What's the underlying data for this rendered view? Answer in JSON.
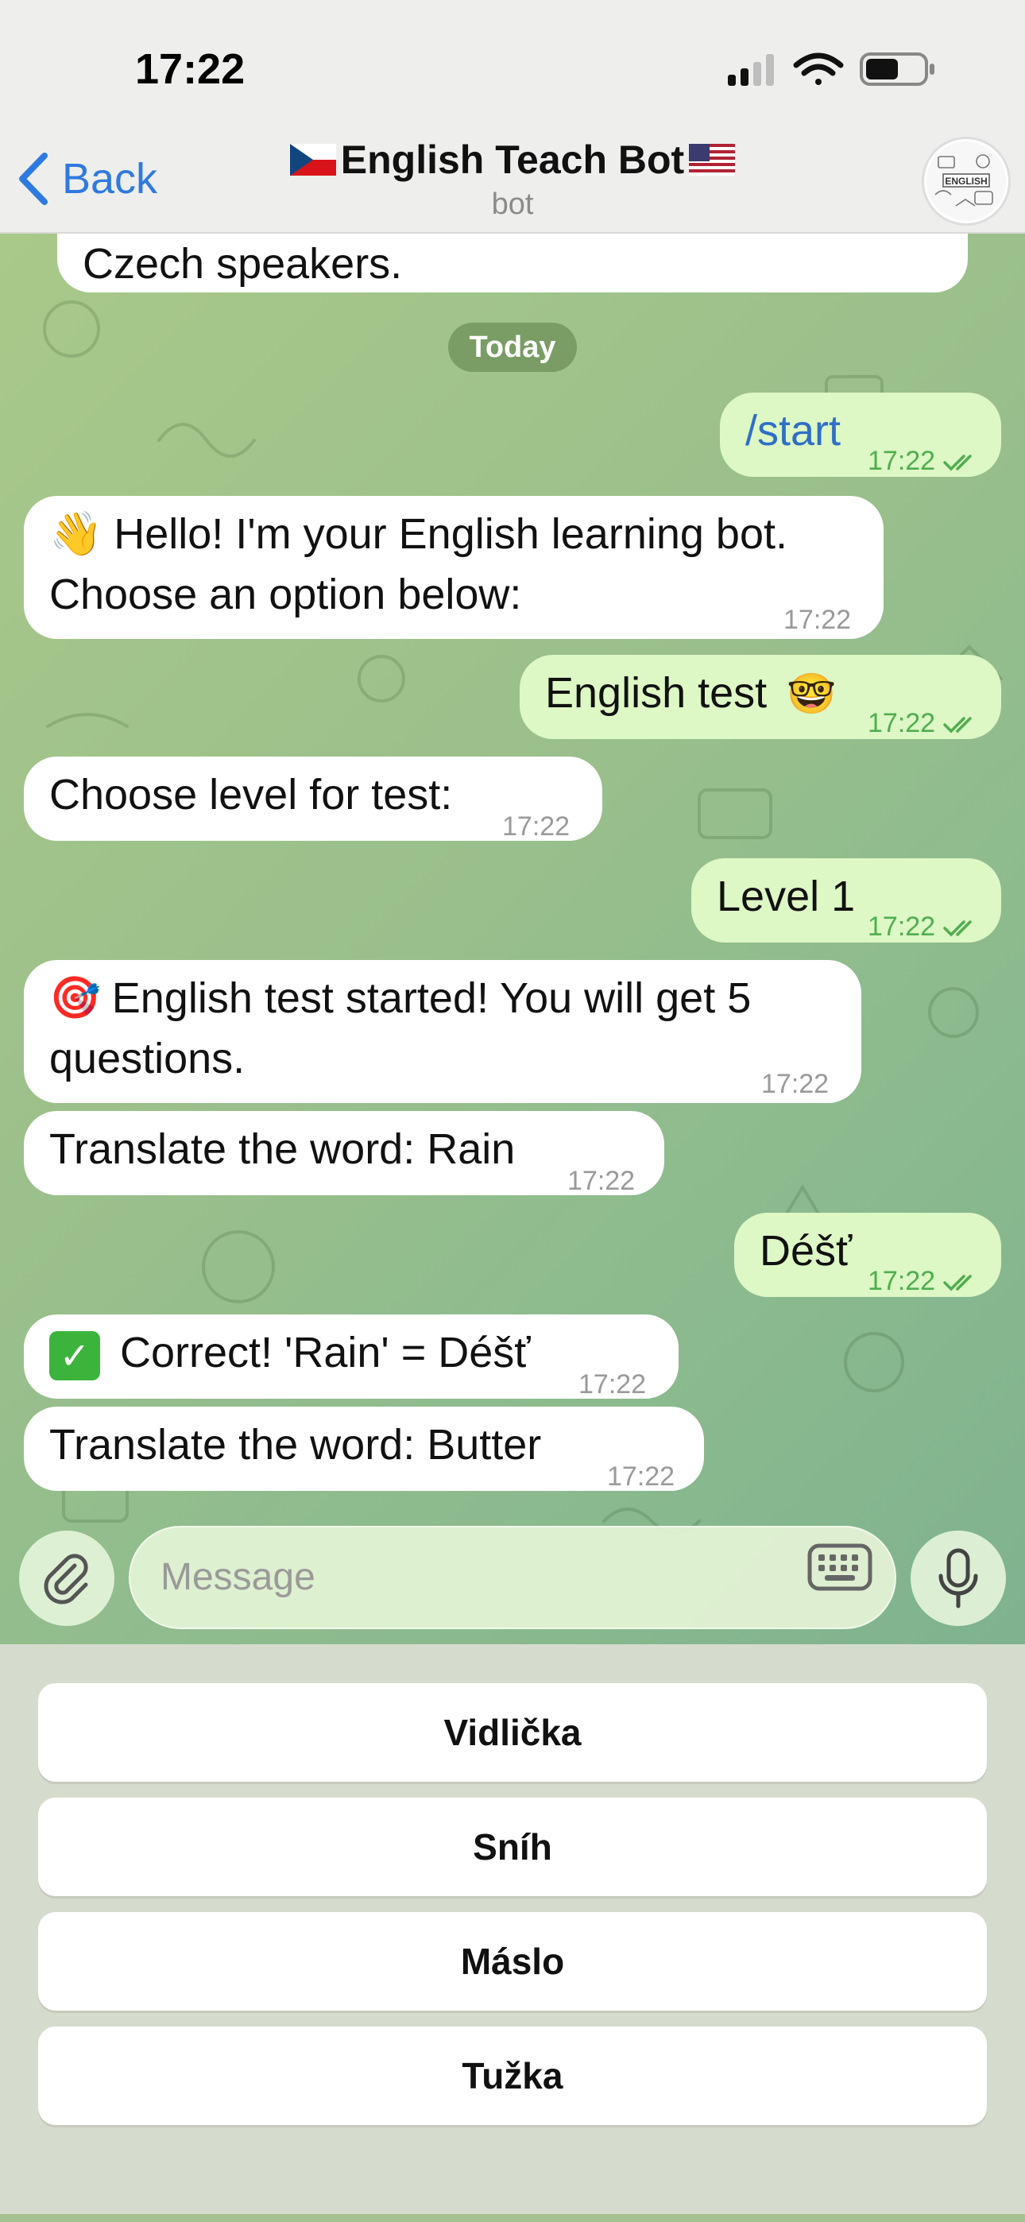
{
  "status_bar": {
    "time": "17:22"
  },
  "header": {
    "back_label": "Back",
    "title_text": "English Teach Bot",
    "subtitle": "bot",
    "avatar_text": "ENGLISH"
  },
  "chat": {
    "date_label": "Today",
    "partial_message": "Czech speakers.",
    "messages": [
      {
        "text": "/start",
        "time": "17:22"
      },
      {
        "line1": "Hello! I'm your English learning bot.",
        "line2": "Choose an option below:",
        "time": "17:22"
      },
      {
        "text": "English test",
        "time": "17:22"
      },
      {
        "text": "Choose level for test:",
        "time": "17:22"
      },
      {
        "text": "Level 1",
        "time": "17:22"
      },
      {
        "line1": "English test started! You will get 5",
        "line2": "questions.",
        "time": "17:22"
      },
      {
        "text": "Translate the word: Rain",
        "time": "17:22"
      },
      {
        "text": "Déšť",
        "time": "17:22"
      },
      {
        "text": "Correct! 'Rain' = Déšť",
        "time": "17:22"
      },
      {
        "text": "Translate the word: Butter",
        "time": "17:22"
      }
    ]
  },
  "input": {
    "placeholder": "Message"
  },
  "keyboard": {
    "buttons": [
      "Vidlička",
      "Sníh",
      "Máslo",
      "Tužka"
    ]
  },
  "colors": {
    "accent": "#2f7ae0",
    "outgoing_bubble": "#ddf7c5",
    "incoming_bubble": "#ffffff",
    "read_check": "#4fae4e"
  }
}
